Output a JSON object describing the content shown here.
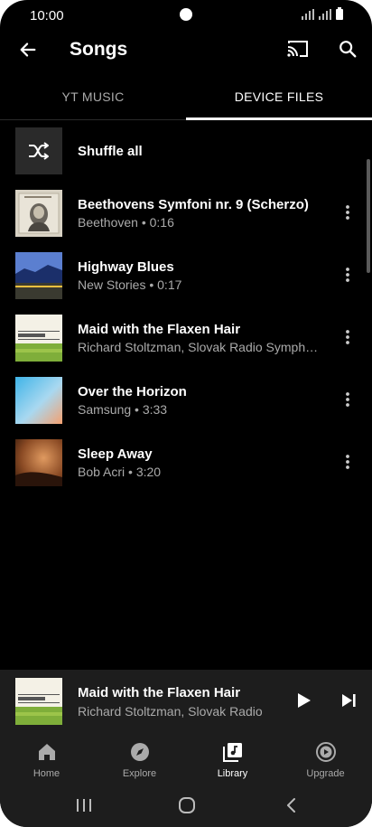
{
  "status_bar": {
    "time": "10:00"
  },
  "app_bar": {
    "title": "Songs",
    "icons": [
      "back-arrow-icon",
      "cast-icon",
      "search-icon"
    ]
  },
  "tabs": [
    {
      "label": "YT MUSIC",
      "selected": false
    },
    {
      "label": "DEVICE FILES",
      "selected": true
    }
  ],
  "shuffle": {
    "label": "Shuffle all",
    "icon": "shuffle-icon"
  },
  "songs": [
    {
      "title": "Beethovens Symfoni nr. 9 (Scherzo)",
      "subtitle": "Beethoven • 0:16"
    },
    {
      "title": "Highway Blues",
      "subtitle": "New Stories • 0:17"
    },
    {
      "title": "Maid with the Flaxen Hair",
      "subtitle": "Richard Stoltzman, Slovak Radio Symph…"
    },
    {
      "title": "Over the Horizon",
      "subtitle": "Samsung • 3:33"
    },
    {
      "title": "Sleep Away",
      "subtitle": "Bob Acri • 3:20"
    }
  ],
  "mini_player": {
    "title": "Maid with the Flaxen Hair",
    "subtitle": "Richard Stoltzman, Slovak Radio",
    "icons": [
      "play-icon",
      "skip-next-icon"
    ]
  },
  "bottom_nav": [
    {
      "label": "Home",
      "icon": "home-icon",
      "active": false
    },
    {
      "label": "Explore",
      "icon": "compass-icon",
      "active": false
    },
    {
      "label": "Library",
      "icon": "library-icon",
      "active": true
    },
    {
      "label": "Upgrade",
      "icon": "upgrade-icon",
      "active": false
    }
  ],
  "colors": {
    "background": "#000000",
    "surface": "#1d1d1d",
    "secondary_text": "#aaaaaa",
    "primary_text": "#ffffff"
  }
}
